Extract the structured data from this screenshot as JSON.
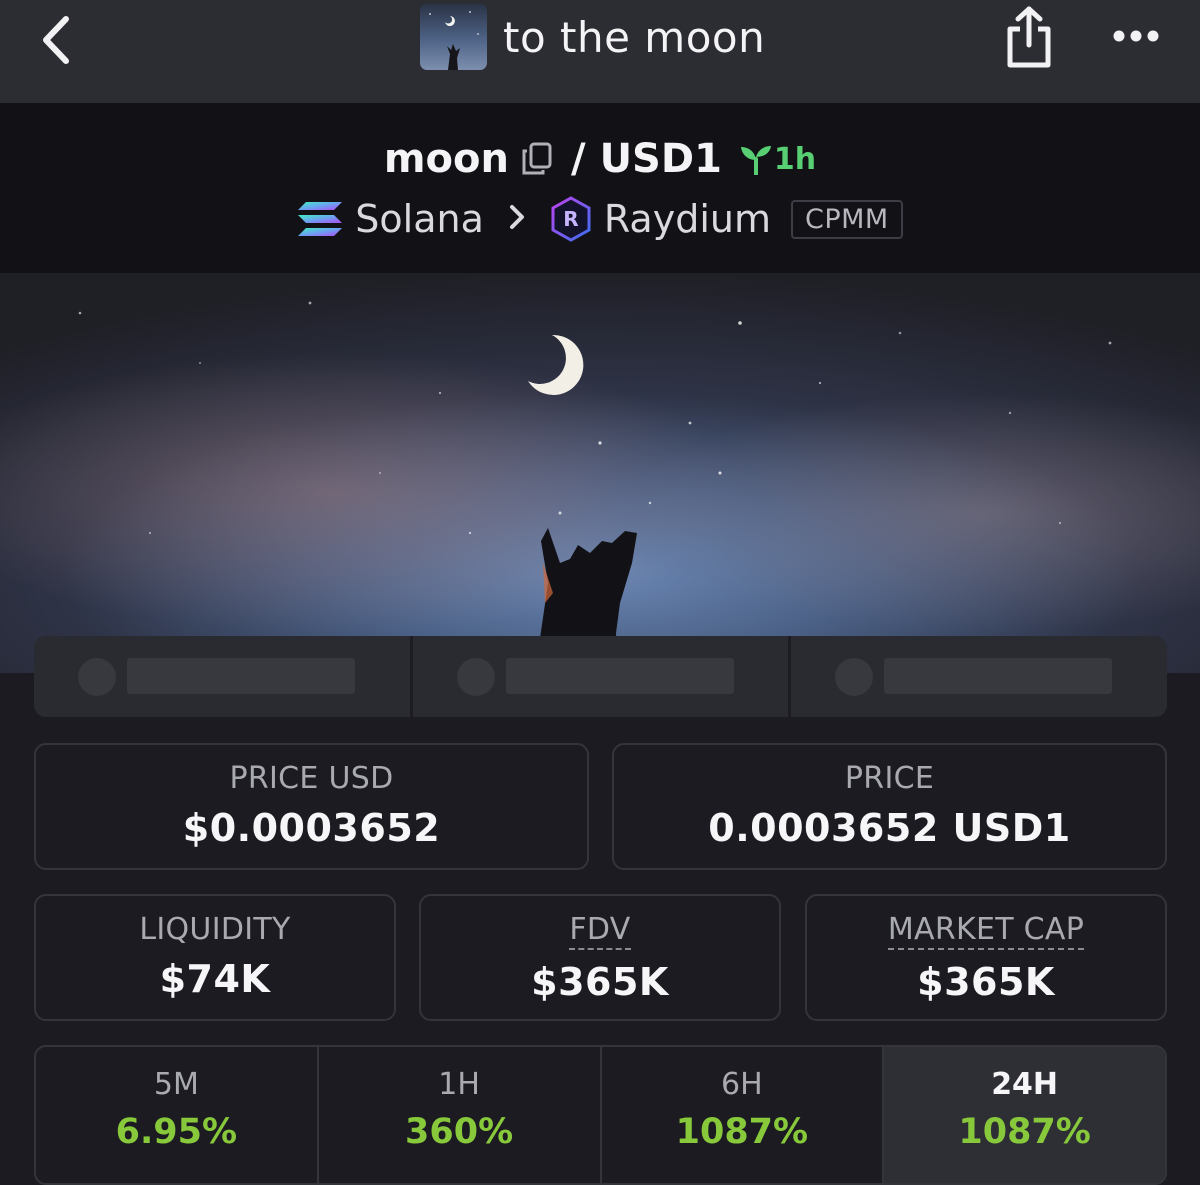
{
  "header": {
    "title": "to the moon"
  },
  "pair": {
    "base": "moon",
    "separator": "/",
    "quote": "USD1",
    "age": "1h",
    "chain": "Solana",
    "dex": "Raydium",
    "pool_type": "CPMM"
  },
  "stats": {
    "price_usd_label": "PRICE USD",
    "price_usd_value": "$0.0003652",
    "price_label": "PRICE",
    "price_value": "0.0003652 USD1",
    "liquidity_label": "LIQUIDITY",
    "liquidity_value": "$74K",
    "fdv_label": "FDV",
    "fdv_value": "$365K",
    "mcap_label": "MARKET CAP",
    "mcap_value": "$365K"
  },
  "timeframes": [
    {
      "label": "5M",
      "value": "6.95%"
    },
    {
      "label": "1H",
      "value": "360%"
    },
    {
      "label": "6H",
      "value": "1087%"
    },
    {
      "label": "24H",
      "value": "1087%"
    }
  ],
  "colors": {
    "background": "#1b1b21",
    "topbar": "#2c2c33",
    "pair_header": "#111116",
    "positive": "#88c93b",
    "age_green": "#57cf72"
  },
  "icons": {
    "back": "chevron-left-icon",
    "share": "share-icon",
    "more": "more-horizontal-icon",
    "copy": "copy-icon",
    "age": "seedling-icon",
    "chain": "solana-logo-icon",
    "dex": "raydium-logo-icon",
    "separator": "chevron-right-icon"
  }
}
